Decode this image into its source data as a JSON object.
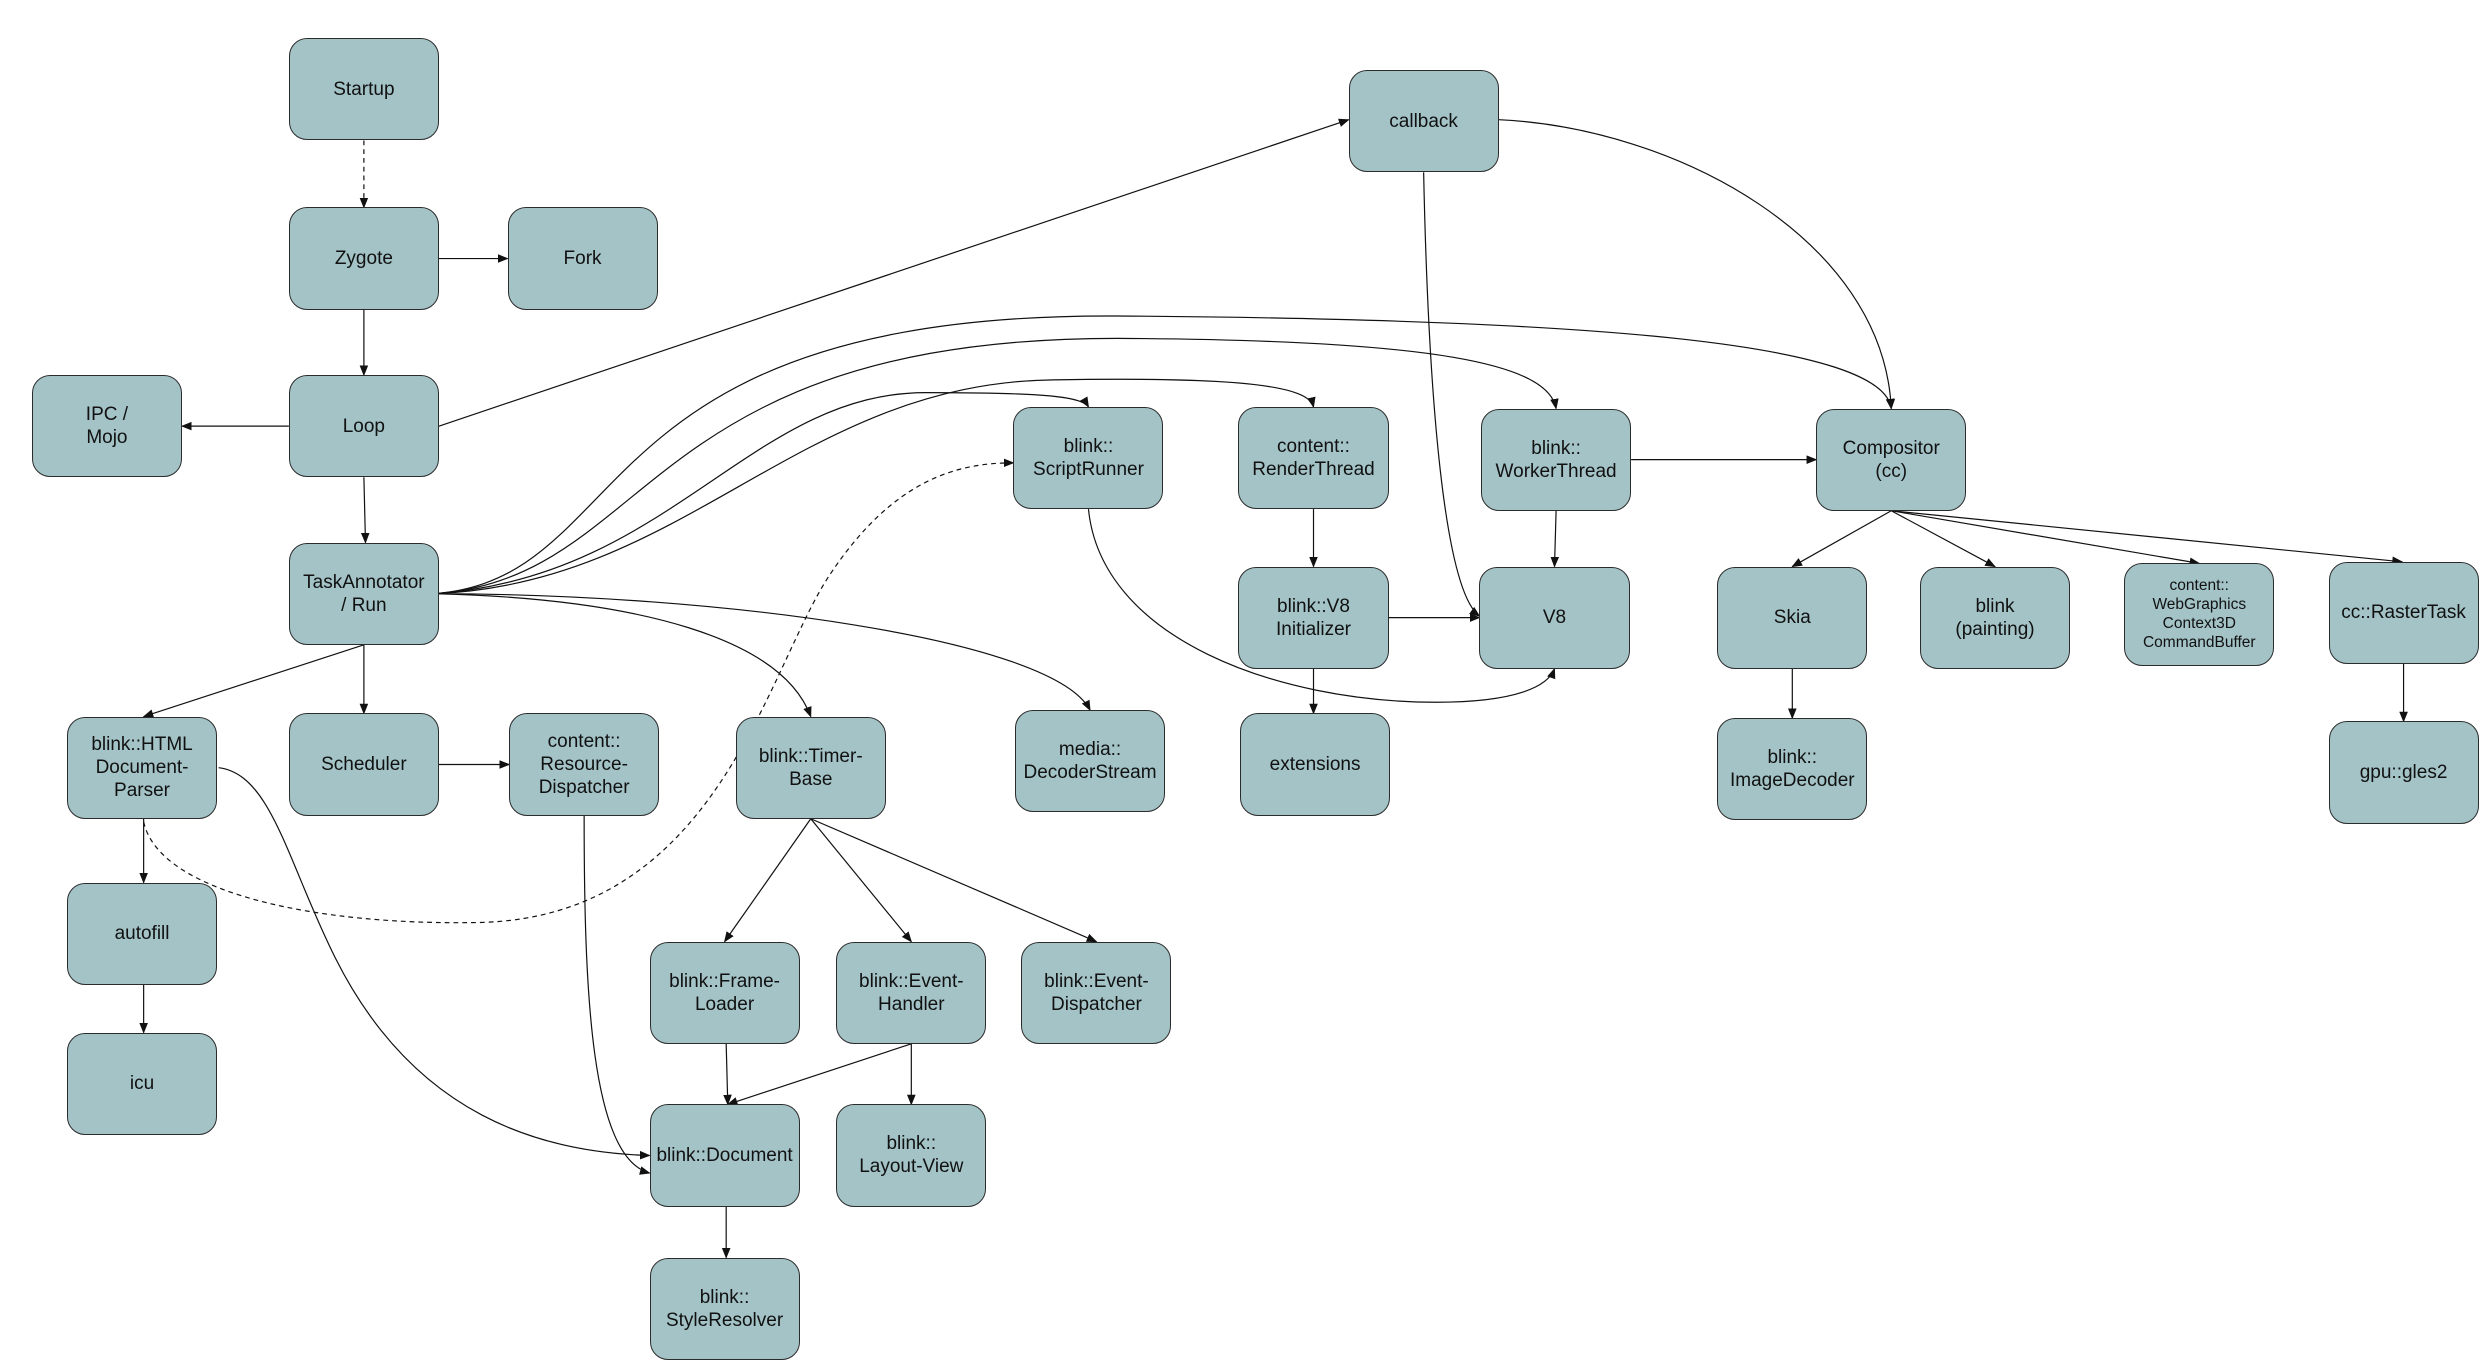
{
  "diagram": {
    "node_color": "#a3c3c7",
    "nodes": [
      {
        "id": "startup",
        "label": "Startup"
      },
      {
        "id": "zygote",
        "label": "Zygote"
      },
      {
        "id": "fork",
        "label": "Fork"
      },
      {
        "id": "ipc",
        "label": "IPC /\nMojo"
      },
      {
        "id": "loop",
        "label": "Loop"
      },
      {
        "id": "taskannotator",
        "label": "TaskAnnotator\n/ Run"
      },
      {
        "id": "htmlparser",
        "label": "blink::HTML\nDocument-\nParser"
      },
      {
        "id": "scheduler",
        "label": "Scheduler"
      },
      {
        "id": "resourcedispatcher",
        "label": "content::\nResource-\nDispatcher"
      },
      {
        "id": "timerbase",
        "label": "blink::Timer-\nBase"
      },
      {
        "id": "decoderstream",
        "label": "media::\nDecoderStream"
      },
      {
        "id": "autofill",
        "label": "autofill"
      },
      {
        "id": "icu",
        "label": "icu"
      },
      {
        "id": "frameloader",
        "label": "blink::Frame-\nLoader"
      },
      {
        "id": "eventhandler",
        "label": "blink::Event-\nHandler"
      },
      {
        "id": "eventdispatcher",
        "label": "blink::Event-\nDispatcher"
      },
      {
        "id": "document",
        "label": "blink::Document"
      },
      {
        "id": "layoutview",
        "label": "blink::\nLayout-View"
      },
      {
        "id": "styleresolver",
        "label": "blink::\nStyleResolver"
      },
      {
        "id": "callback",
        "label": "callback"
      },
      {
        "id": "scriptrunner",
        "label": "blink::\nScriptRunner"
      },
      {
        "id": "renderthread",
        "label": "content::\nRenderThread"
      },
      {
        "id": "workerthread",
        "label": "blink::\nWorkerThread"
      },
      {
        "id": "compositor",
        "label": "Compositor\n(cc)"
      },
      {
        "id": "v8init",
        "label": "blink::V8\nInitializer"
      },
      {
        "id": "v8",
        "label": "V8"
      },
      {
        "id": "extensions",
        "label": "extensions"
      },
      {
        "id": "skia",
        "label": "Skia"
      },
      {
        "id": "painting",
        "label": "blink\n(painting)"
      },
      {
        "id": "webgraphics",
        "label": "content::\nWebGraphics\nContext3D\nCommandBuffer"
      },
      {
        "id": "rastertask",
        "label": "cc::RasterTask"
      },
      {
        "id": "imagedecoder",
        "label": "blink::\nImageDecoder"
      },
      {
        "id": "gles2",
        "label": "gpu::gles2"
      }
    ],
    "edges": [
      {
        "from": "startup",
        "to": "zygote",
        "style": "dashed"
      },
      {
        "from": "zygote",
        "to": "fork",
        "style": "solid"
      },
      {
        "from": "zygote",
        "to": "loop",
        "style": "solid"
      },
      {
        "from": "loop",
        "to": "ipc",
        "style": "solid"
      },
      {
        "from": "loop",
        "to": "callback",
        "style": "solid"
      },
      {
        "from": "loop",
        "to": "taskannotator",
        "style": "solid"
      },
      {
        "from": "taskannotator",
        "to": "compositor",
        "style": "solid"
      },
      {
        "from": "taskannotator",
        "to": "workerthread",
        "style": "solid"
      },
      {
        "from": "taskannotator",
        "to": "scriptrunner",
        "style": "solid"
      },
      {
        "from": "taskannotator",
        "to": "renderthread",
        "style": "solid"
      },
      {
        "from": "taskannotator",
        "to": "timerbase",
        "style": "solid"
      },
      {
        "from": "taskannotator",
        "to": "decoderstream",
        "style": "solid"
      },
      {
        "from": "taskannotator",
        "to": "htmlparser",
        "style": "solid"
      },
      {
        "from": "taskannotator",
        "to": "scheduler",
        "style": "solid"
      },
      {
        "from": "scheduler",
        "to": "resourcedispatcher",
        "style": "solid"
      },
      {
        "from": "htmlparser",
        "to": "autofill",
        "style": "solid"
      },
      {
        "from": "autofill",
        "to": "icu",
        "style": "solid"
      },
      {
        "from": "htmlparser",
        "to": "scriptrunner",
        "style": "dashed"
      },
      {
        "from": "htmlparser",
        "to": "document",
        "style": "solid"
      },
      {
        "from": "resourcedispatcher",
        "to": "document",
        "style": "solid"
      },
      {
        "from": "timerbase",
        "to": "frameloader",
        "style": "solid"
      },
      {
        "from": "timerbase",
        "to": "eventhandler",
        "style": "solid"
      },
      {
        "from": "timerbase",
        "to": "eventdispatcher",
        "style": "solid"
      },
      {
        "from": "frameloader",
        "to": "document",
        "style": "solid"
      },
      {
        "from": "eventhandler",
        "to": "document",
        "style": "solid"
      },
      {
        "from": "eventhandler",
        "to": "layoutview",
        "style": "solid"
      },
      {
        "from": "document",
        "to": "styleresolver",
        "style": "solid"
      },
      {
        "from": "callback",
        "to": "compositor",
        "style": "solid"
      },
      {
        "from": "callback",
        "to": "v8",
        "style": "solid"
      },
      {
        "from": "scriptrunner",
        "to": "v8",
        "style": "solid"
      },
      {
        "from": "renderthread",
        "to": "v8init",
        "style": "solid"
      },
      {
        "from": "v8init",
        "to": "v8",
        "style": "solid"
      },
      {
        "from": "v8init",
        "to": "extensions",
        "style": "solid"
      },
      {
        "from": "workerthread",
        "to": "v8",
        "style": "solid"
      },
      {
        "from": "workerthread",
        "to": "compositor",
        "style": "solid"
      },
      {
        "from": "compositor",
        "to": "skia",
        "style": "solid"
      },
      {
        "from": "compositor",
        "to": "painting",
        "style": "solid"
      },
      {
        "from": "compositor",
        "to": "webgraphics",
        "style": "solid"
      },
      {
        "from": "compositor",
        "to": "rastertask",
        "style": "solid"
      },
      {
        "from": "skia",
        "to": "imagedecoder",
        "style": "solid"
      },
      {
        "from": "rastertask",
        "to": "gles2",
        "style": "solid"
      }
    ]
  }
}
